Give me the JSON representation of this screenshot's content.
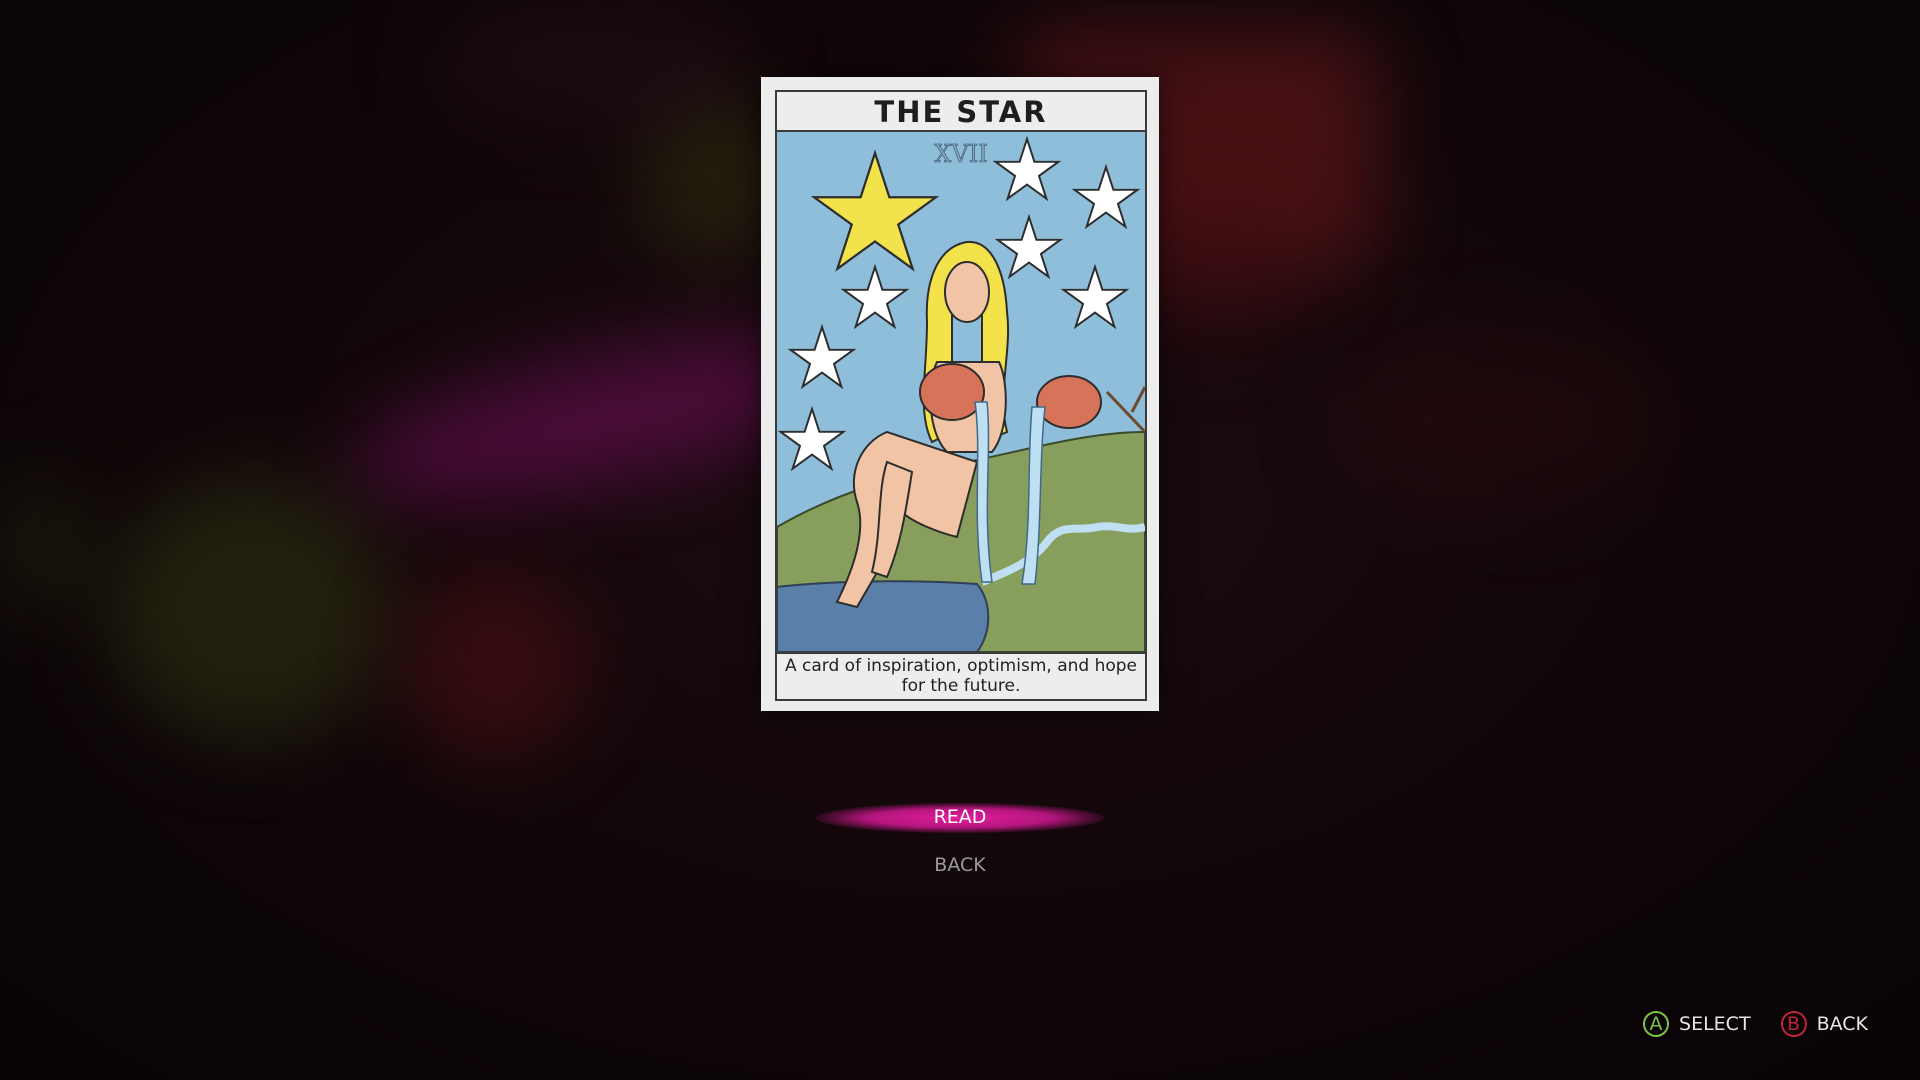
{
  "card": {
    "title": "THE STAR",
    "numeral": "XVII",
    "caption": "A card of inspiration, optimism, and hope for the future."
  },
  "menu": {
    "items": [
      {
        "label": "READ",
        "selected": true
      },
      {
        "label": "BACK",
        "selected": false
      }
    ]
  },
  "controller_hints": [
    {
      "button": "A",
      "label": "SELECT",
      "color": "#7fc24a"
    },
    {
      "button": "B",
      "label": "BACK",
      "color": "#c0213b"
    }
  ],
  "colors": {
    "accent": "#e01f9c",
    "sky": "#8fbedb",
    "star_main": "#f2e34c"
  }
}
